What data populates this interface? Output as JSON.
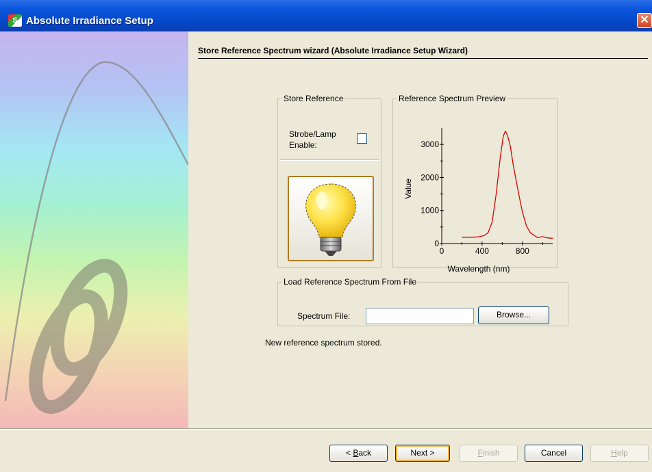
{
  "window": {
    "title": "Absolute Irradiance Setup",
    "icon": "app-logo-icon",
    "icon_text": "S",
    "close_glyph": "✕"
  },
  "heading": "Store Reference Spectrum wizard (Absolute Irradiance Setup Wizard)",
  "store_reference": {
    "legend": "Store Reference",
    "strobe_label_line1": "Strobe/Lamp",
    "strobe_label_line2": "Enable:",
    "strobe_checked": false,
    "bulb_icon": "light-bulb-icon"
  },
  "preview": {
    "legend": "Reference Spectrum Preview"
  },
  "chart_data": {
    "type": "line",
    "xlabel": "Wavelength (nm)",
    "ylabel": "Value",
    "xlim": [
      0,
      1100
    ],
    "ylim": [
      0,
      3500
    ],
    "x_ticks": [
      0,
      400,
      800
    ],
    "y_ticks": [
      0,
      1000,
      2000,
      3000
    ],
    "series": [
      {
        "color": "#dd0000",
        "x": [
          200,
          300,
          360,
          420,
          460,
          500,
          540,
          580,
          610,
          630,
          650,
          680,
          710,
          760,
          800,
          840,
          880,
          950,
          1000,
          1050,
          1100
        ],
        "y": [
          190,
          190,
          200,
          240,
          330,
          650,
          1500,
          2600,
          3250,
          3400,
          3300,
          2950,
          2350,
          1550,
          950,
          530,
          320,
          180,
          210,
          170,
          160
        ]
      }
    ]
  },
  "load_reference": {
    "legend": "Load Reference Spectrum From File",
    "spectrum_file_label": "Spectrum File:",
    "spectrum_file_value": "",
    "browse_label": "Browse..."
  },
  "status": "New reference spectrum stored.",
  "buttons": {
    "back_prefix": "< ",
    "back_mnemonic": "B",
    "back_rest": "ack",
    "next": "Next >",
    "finish_mnemonic": "F",
    "finish_rest": "inish",
    "cancel": "Cancel",
    "help_mnemonic": "H",
    "help_rest": "elp"
  }
}
